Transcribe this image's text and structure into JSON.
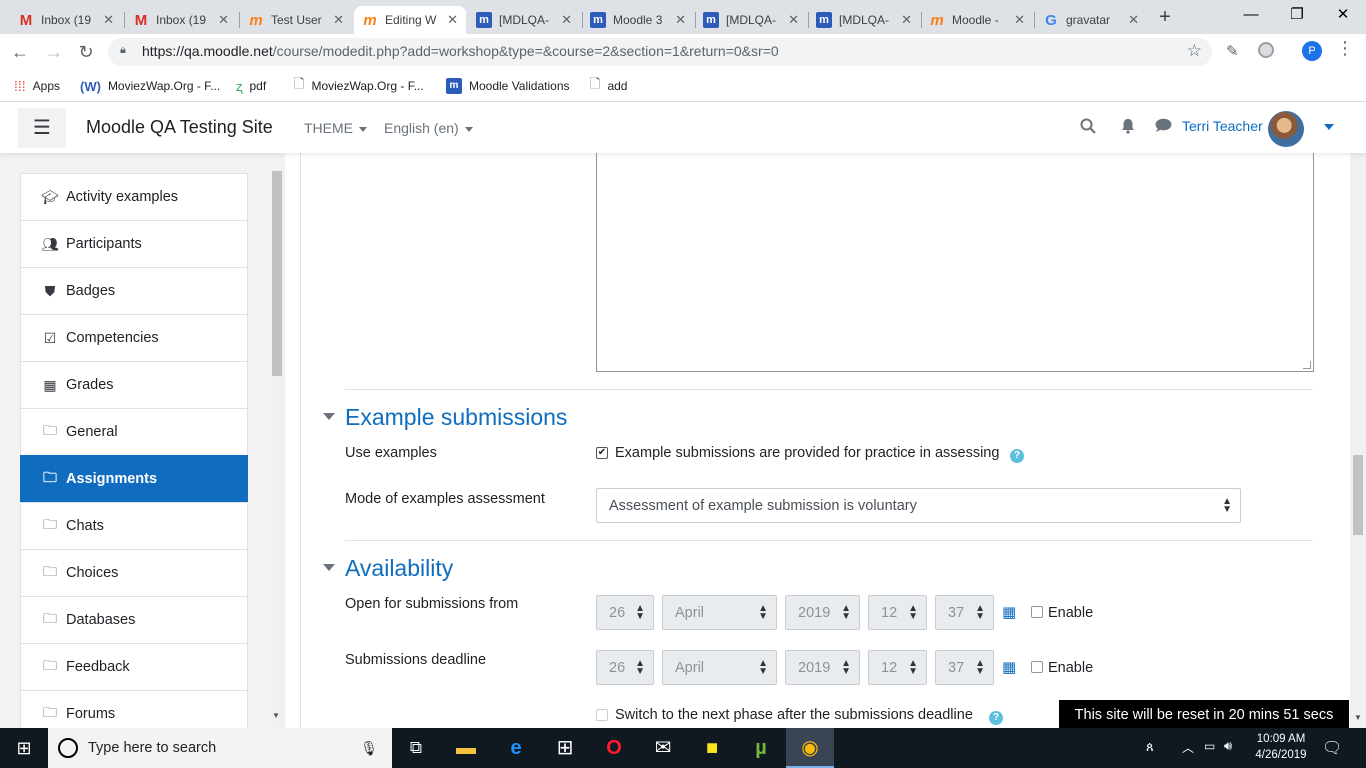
{
  "browser": {
    "tabs": [
      {
        "title": "Inbox (19",
        "icon": "gmail-icon"
      },
      {
        "title": "Inbox (19",
        "icon": "gmail-icon"
      },
      {
        "title": "Test User",
        "icon": "moodle-icon"
      },
      {
        "title": "Editing W",
        "icon": "moodle-icon",
        "active": true
      },
      {
        "title": "[MDLQA-",
        "icon": "moodle-docs-icon"
      },
      {
        "title": "Moodle 3",
        "icon": "moodle-docs-icon"
      },
      {
        "title": "[MDLQA-",
        "icon": "moodle-docs-icon"
      },
      {
        "title": "[MDLQA-",
        "icon": "moodle-docs-icon"
      },
      {
        "title": "Moodle -",
        "icon": "moodle-icon"
      },
      {
        "title": "gravatar",
        "icon": "google-icon"
      }
    ],
    "url_host": "https://qa.moodle.net",
    "url_path": "/course/modedit.php?add=workshop&type=&course=2&section=1&return=0&sr=0",
    "profile_initial": "P",
    "bookmarks": [
      {
        "label": "Apps",
        "icon": "apps-grid-icon"
      },
      {
        "label": "MoviezWap.Org - F...",
        "icon": "wordpress-icon"
      },
      {
        "label": "pdf",
        "icon": "pdf-icon"
      },
      {
        "label": "MoviezWap.Org - F...",
        "icon": "page-icon"
      },
      {
        "label": "Moodle Validations",
        "icon": "moodle-docs-icon"
      },
      {
        "label": "add",
        "icon": "page-icon"
      }
    ]
  },
  "moodle": {
    "site_name": "Moodle QA Testing Site",
    "theme_menu": "THEME",
    "language_menu": "English (en)",
    "user_name": "Terri Teacher",
    "nav_items": [
      {
        "label": "Activity examples",
        "icon": "graduation-cap-icon"
      },
      {
        "label": "Participants",
        "icon": "users-icon"
      },
      {
        "label": "Badges",
        "icon": "shield-icon"
      },
      {
        "label": "Competencies",
        "icon": "check-square-icon"
      },
      {
        "label": "Grades",
        "icon": "table-icon"
      },
      {
        "label": "General",
        "icon": "folder-icon"
      },
      {
        "label": "Assignments",
        "icon": "folder-icon",
        "active": true
      },
      {
        "label": "Chats",
        "icon": "folder-icon"
      },
      {
        "label": "Choices",
        "icon": "folder-icon"
      },
      {
        "label": "Databases",
        "icon": "folder-icon"
      },
      {
        "label": "Feedback",
        "icon": "folder-icon"
      },
      {
        "label": "Forums",
        "icon": "folder-icon"
      }
    ],
    "example_submissions": {
      "heading": "Example submissions",
      "use_examples_label": "Use examples",
      "use_examples_text": "Example submissions are provided for practice in assessing",
      "use_examples_checked": true,
      "mode_label": "Mode of examples assessment",
      "mode_value": "Assessment of example submission is voluntary"
    },
    "availability": {
      "heading": "Availability",
      "open_label": "Open for submissions from",
      "open": {
        "day": "26",
        "month": "April",
        "year": "2019",
        "hour": "12",
        "minute": "37",
        "enable": "Enable"
      },
      "deadline_label": "Submissions deadline",
      "deadline": {
        "day": "26",
        "month": "April",
        "year": "2019",
        "hour": "12",
        "minute": "37",
        "enable": "Enable"
      },
      "switch_phase_text": "Switch to the next phase after the submissions deadline"
    },
    "reset_notice": "This site will be reset in 20 mins 51 secs"
  },
  "taskbar": {
    "search_placeholder": "Type here to search",
    "time": "10:09 AM",
    "date": "4/26/2019"
  }
}
